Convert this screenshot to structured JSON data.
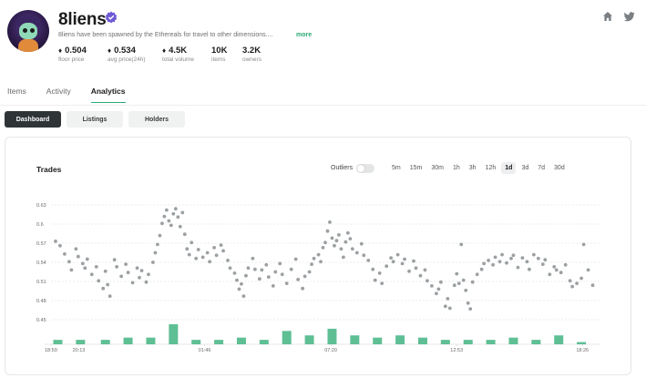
{
  "collection": {
    "name": "8liens",
    "description": "8liens have been spawned by the Ethereals for travel to other dimensions....",
    "more_label": "more",
    "accent": "#2aa876",
    "verified_color": "#6f5ad6"
  },
  "stats": [
    {
      "value": "0.504",
      "label": "floor price",
      "eth": true
    },
    {
      "value": "0.534",
      "label": "avg price(24h)",
      "eth": true
    },
    {
      "value": "4.5K",
      "label": "total volume",
      "eth": true
    },
    {
      "value": "10K",
      "label": "items",
      "eth": false
    },
    {
      "value": "3.2K",
      "label": "owners",
      "eth": false
    }
  ],
  "header_icons": [
    "home-icon",
    "twitter-icon"
  ],
  "tabs": [
    {
      "label": "Items"
    },
    {
      "label": "Activity"
    },
    {
      "label": "Analytics",
      "active": true
    }
  ],
  "subtabs": [
    {
      "label": "Dashboard",
      "active": true
    },
    {
      "label": "Listings"
    },
    {
      "label": "Holders"
    }
  ],
  "chart_controls": {
    "title": "Trades",
    "outliers_label": "Outliers",
    "outliers_on": false,
    "ranges": [
      "5m",
      "15m",
      "30m",
      "1h",
      "3h",
      "12h",
      "1d",
      "3d",
      "7d",
      "30d"
    ],
    "active_range": "1d"
  },
  "chart_data": {
    "type": "scatter",
    "title": "Trades",
    "y_ticks": [
      "0.63",
      "0.6",
      "0.57",
      "0.54",
      "0.51",
      "0.48",
      "0.45"
    ],
    "ylim": [
      0.45,
      0.63
    ],
    "x_ticks": [
      "18:59",
      "20:13",
      "01:46",
      "07:20",
      "12:53",
      "18:26"
    ],
    "x_hours": [
      0,
      1.23,
      6.78,
      12.35,
      17.9,
      23.45
    ],
    "xlim": [
      0,
      24.2
    ],
    "grid": true,
    "point_color": "#8a8f93",
    "bar_color": "#5fbf94",
    "points": [
      [
        0.2,
        0.573
      ],
      [
        0.4,
        0.566
      ],
      [
        0.6,
        0.553
      ],
      [
        0.8,
        0.541
      ],
      [
        0.9,
        0.528
      ],
      [
        1.1,
        0.561
      ],
      [
        1.2,
        0.549
      ],
      [
        1.4,
        0.538
      ],
      [
        1.5,
        0.531
      ],
      [
        1.6,
        0.545
      ],
      [
        1.8,
        0.521
      ],
      [
        2.0,
        0.533
      ],
      [
        2.1,
        0.511
      ],
      [
        2.3,
        0.499
      ],
      [
        2.4,
        0.526
      ],
      [
        2.5,
        0.505
      ],
      [
        2.6,
        0.487
      ],
      [
        2.8,
        0.544
      ],
      [
        2.9,
        0.533
      ],
      [
        3.1,
        0.518
      ],
      [
        3.3,
        0.537
      ],
      [
        3.4,
        0.524
      ],
      [
        3.6,
        0.508
      ],
      [
        3.8,
        0.531
      ],
      [
        3.9,
        0.516
      ],
      [
        4.0,
        0.527
      ],
      [
        4.2,
        0.509
      ],
      [
        4.3,
        0.521
      ],
      [
        4.5,
        0.54
      ],
      [
        4.6,
        0.555
      ],
      [
        4.7,
        0.568
      ],
      [
        4.8,
        0.582
      ],
      [
        4.9,
        0.601
      ],
      [
        5.0,
        0.612
      ],
      [
        5.1,
        0.622
      ],
      [
        5.2,
        0.605
      ],
      [
        5.3,
        0.598
      ],
      [
        5.4,
        0.616
      ],
      [
        5.5,
        0.624
      ],
      [
        5.6,
        0.611
      ],
      [
        5.7,
        0.596
      ],
      [
        5.8,
        0.618
      ],
      [
        5.9,
        0.584
      ],
      [
        6.0,
        0.561
      ],
      [
        6.1,
        0.552
      ],
      [
        6.2,
        0.571
      ],
      [
        6.4,
        0.546
      ],
      [
        6.5,
        0.56
      ],
      [
        6.7,
        0.548
      ],
      [
        6.9,
        0.555
      ],
      [
        7.0,
        0.541
      ],
      [
        7.2,
        0.563
      ],
      [
        7.3,
        0.551
      ],
      [
        7.5,
        0.567
      ],
      [
        7.6,
        0.558
      ],
      [
        7.8,
        0.543
      ],
      [
        7.9,
        0.531
      ],
      [
        8.1,
        0.523
      ],
      [
        8.2,
        0.512
      ],
      [
        8.3,
        0.498
      ],
      [
        8.4,
        0.506
      ],
      [
        8.5,
        0.487
      ],
      [
        8.6,
        0.519
      ],
      [
        8.7,
        0.531
      ],
      [
        8.9,
        0.546
      ],
      [
        9.0,
        0.529
      ],
      [
        9.2,
        0.514
      ],
      [
        9.3,
        0.528
      ],
      [
        9.5,
        0.536
      ],
      [
        9.6,
        0.517
      ],
      [
        9.8,
        0.503
      ],
      [
        9.9,
        0.525
      ],
      [
        10.1,
        0.538
      ],
      [
        10.2,
        0.521
      ],
      [
        10.4,
        0.507
      ],
      [
        10.6,
        0.529
      ],
      [
        10.8,
        0.545
      ],
      [
        10.9,
        0.513
      ],
      [
        11.1,
        0.499
      ],
      [
        11.2,
        0.518
      ],
      [
        11.4,
        0.525
      ],
      [
        11.5,
        0.537
      ],
      [
        11.6,
        0.546
      ],
      [
        11.8,
        0.552
      ],
      [
        11.9,
        0.541
      ],
      [
        12.0,
        0.563
      ],
      [
        12.1,
        0.571
      ],
      [
        12.2,
        0.589
      ],
      [
        12.3,
        0.603
      ],
      [
        12.4,
        0.578
      ],
      [
        12.5,
        0.566
      ],
      [
        12.6,
        0.574
      ],
      [
        12.7,
        0.583
      ],
      [
        12.8,
        0.561
      ],
      [
        12.9,
        0.548
      ],
      [
        13.0,
        0.572
      ],
      [
        13.1,
        0.586
      ],
      [
        13.2,
        0.577
      ],
      [
        13.3,
        0.561
      ],
      [
        13.5,
        0.555
      ],
      [
        13.7,
        0.569
      ],
      [
        13.8,
        0.551
      ],
      [
        14.0,
        0.543
      ],
      [
        14.2,
        0.529
      ],
      [
        14.3,
        0.512
      ],
      [
        14.5,
        0.523
      ],
      [
        14.6,
        0.507
      ],
      [
        14.8,
        0.534
      ],
      [
        15.0,
        0.547
      ],
      [
        15.1,
        0.541
      ],
      [
        15.3,
        0.552
      ],
      [
        15.5,
        0.538
      ],
      [
        15.6,
        0.545
      ],
      [
        15.8,
        0.526
      ],
      [
        16.0,
        0.542
      ],
      [
        16.1,
        0.531
      ],
      [
        16.3,
        0.519
      ],
      [
        16.5,
        0.528
      ],
      [
        16.6,
        0.511
      ],
      [
        16.8,
        0.503
      ],
      [
        17.0,
        0.491
      ],
      [
        17.1,
        0.498
      ],
      [
        17.2,
        0.509
      ],
      [
        17.4,
        0.471
      ],
      [
        17.5,
        0.483
      ],
      [
        17.6,
        0.468
      ],
      [
        17.8,
        0.504
      ],
      [
        17.9,
        0.522
      ],
      [
        18.0,
        0.507
      ],
      [
        18.1,
        0.568
      ],
      [
        18.2,
        0.512
      ],
      [
        18.3,
        0.496
      ],
      [
        18.4,
        0.476
      ],
      [
        18.5,
        0.467
      ],
      [
        18.6,
        0.509
      ],
      [
        18.8,
        0.521
      ],
      [
        19.0,
        0.529
      ],
      [
        19.1,
        0.538
      ],
      [
        19.3,
        0.543
      ],
      [
        19.5,
        0.536
      ],
      [
        19.6,
        0.548
      ],
      [
        19.8,
        0.541
      ],
      [
        19.9,
        0.552
      ],
      [
        20.1,
        0.539
      ],
      [
        20.3,
        0.546
      ],
      [
        20.4,
        0.551
      ],
      [
        20.6,
        0.532
      ],
      [
        20.8,
        0.547
      ],
      [
        21.0,
        0.541
      ],
      [
        21.1,
        0.529
      ],
      [
        21.3,
        0.552
      ],
      [
        21.5,
        0.546
      ],
      [
        21.7,
        0.537
      ],
      [
        21.8,
        0.544
      ],
      [
        22.0,
        0.521
      ],
      [
        22.2,
        0.533
      ],
      [
        22.3,
        0.528
      ],
      [
        22.5,
        0.524
      ],
      [
        22.7,
        0.536
      ],
      [
        22.9,
        0.511
      ],
      [
        23.0,
        0.502
      ],
      [
        23.2,
        0.507
      ],
      [
        23.4,
        0.515
      ],
      [
        23.5,
        0.568
      ],
      [
        23.7,
        0.528
      ],
      [
        23.9,
        0.504
      ]
    ],
    "volume_hours": [
      0.3,
      1.3,
      2.4,
      3.4,
      4.4,
      5.4,
      6.4,
      7.4,
      8.4,
      9.4,
      10.4,
      11.4,
      12.4,
      13.4,
      14.4,
      15.4,
      16.4,
      17.4,
      18.4,
      19.4,
      20.4,
      21.4,
      22.4,
      23.4
    ],
    "volume_values": [
      2,
      2,
      2,
      3,
      3,
      9,
      2,
      2,
      3,
      2,
      6,
      4,
      7,
      4,
      3,
      4,
      3,
      2,
      2,
      2,
      3,
      2,
      4,
      1
    ]
  }
}
